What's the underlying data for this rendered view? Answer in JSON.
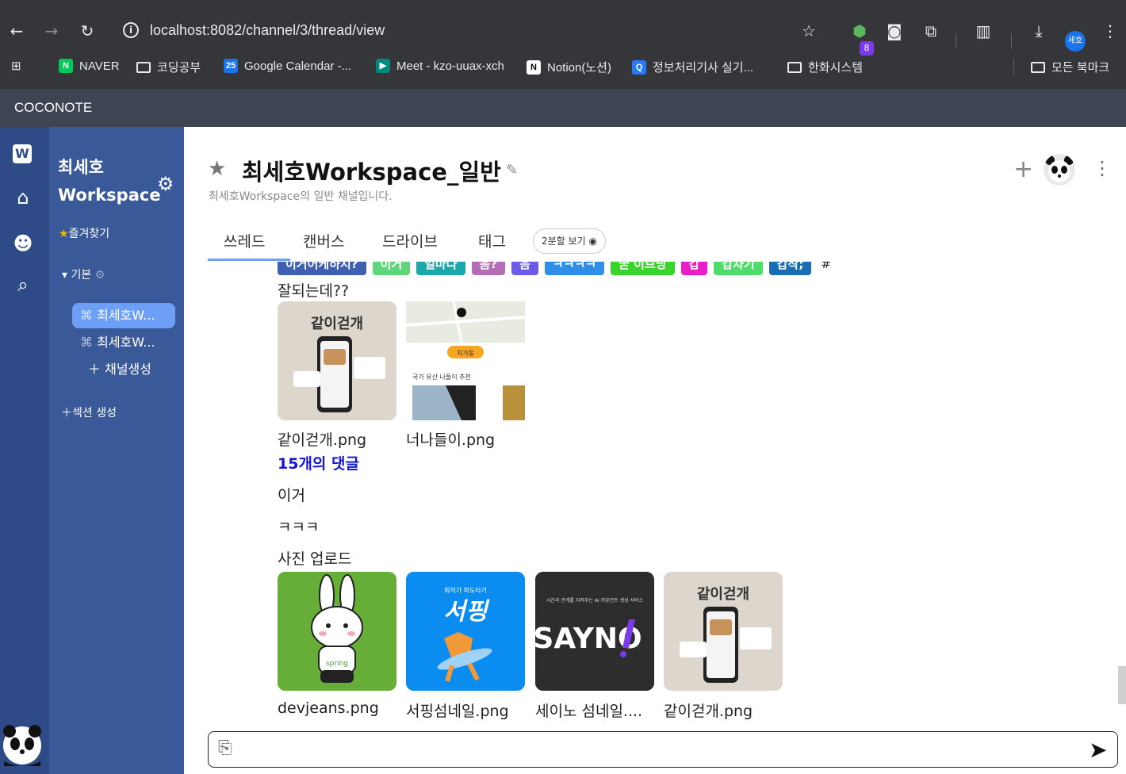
{
  "browser": {
    "url": "localhost:8082/channel/3/thread/view",
    "ext_badge": "8",
    "profile": "세호",
    "bookmarks": [
      "NAVER",
      "코딩공부",
      "Google Calendar -...",
      "Meet - kzo-uuax-xch",
      "Notion(노션)",
      "정보처리기사 실기...",
      "한화시스템"
    ],
    "all_bookmarks": "모든 북마크"
  },
  "app": {
    "title": "COCONOTE"
  },
  "sidebar": {
    "workspace_line1": "최세호",
    "workspace_line2": "Workspace",
    "favorites": "즐겨찾기",
    "section": "기본",
    "channels": [
      "최세호W...",
      "최세호W..."
    ],
    "create_channel": "채널생성",
    "create_section": "섹션 생성"
  },
  "channel": {
    "title": "최세호Workspace_일반",
    "description": "최세호Workspace의 일반 채널입니다."
  },
  "tabs": [
    "쓰레드",
    "캔버스",
    "드라이브",
    "태그"
  ],
  "split_view": "2분할 보기",
  "thread": {
    "tags": [
      {
        "label": "이거어케하시?",
        "color": "#3f5fb0"
      },
      {
        "label": "이거",
        "color": "#5fd67a"
      },
      {
        "label": "얼마나",
        "color": "#1aa8a8"
      },
      {
        "label": "음?",
        "color": "#b46eb4"
      },
      {
        "label": "음",
        "color": "#6a5be8"
      },
      {
        "label": "ㅋㅋㅋㅋ",
        "color": "#2f8ee8"
      },
      {
        "label": "굳 이브닝",
        "color": "#39d52c"
      },
      {
        "label": "갑",
        "color": "#e81ec8"
      },
      {
        "label": "갑자기",
        "color": "#4fdc6a"
      },
      {
        "label": "갑작;",
        "color": "#1a6cb4"
      }
    ],
    "tag_hash": "#",
    "msg1": "잘되는데??",
    "files1": [
      "같이걷개.png",
      "너나들이.png"
    ],
    "comments": "15개의 댓글",
    "msg2": "이거",
    "msg3": "ㅋㅋㅋ",
    "msg4": "사진 업로드",
    "files2": [
      "devjeans.png",
      "서핑섬네일.png",
      "세이노 섬네일....",
      "같이걷개.png"
    ],
    "thumb_texts": {
      "gachi": "같이걷개",
      "surfing": "서핑",
      "surfing_sub": "최저가 파도타기",
      "sayno": "SAYNO",
      "sayno_sub": "시간과 관계를 지켜주는 AI 커뮤먼트 생성 서비스",
      "spring": "spring",
      "map_chip": "지가동",
      "map_caption": "국가 유산 나들이 추천"
    }
  }
}
